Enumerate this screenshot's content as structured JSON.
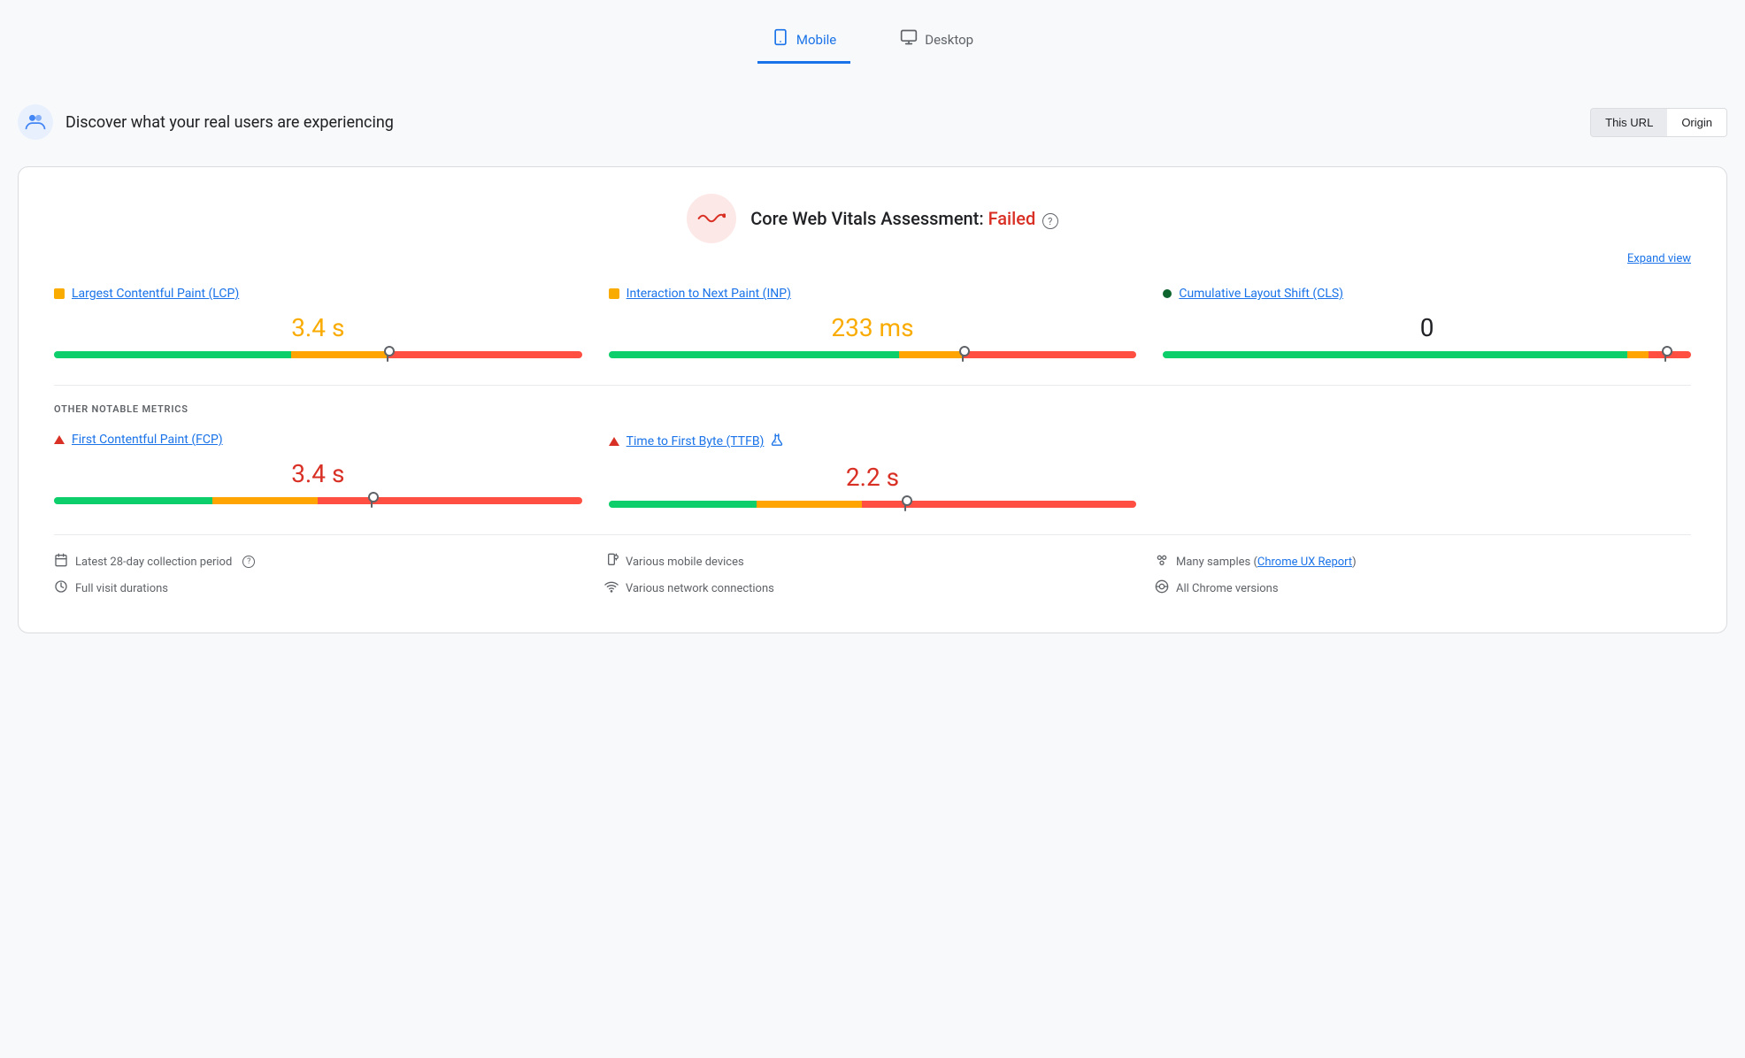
{
  "tabs": [
    {
      "id": "mobile",
      "label": "Mobile",
      "icon": "📱",
      "active": true
    },
    {
      "id": "desktop",
      "label": "Desktop",
      "icon": "🖥",
      "active": false
    }
  ],
  "header": {
    "title": "Discover what your real users are experiencing",
    "avatar_icon": "👥",
    "url_toggle": {
      "this_url": "This URL",
      "origin": "Origin",
      "active": "this_url"
    }
  },
  "assessment": {
    "title_prefix": "Core Web Vitals Assessment: ",
    "status": "Failed",
    "icon": "📉",
    "expand_label": "Expand view",
    "help_icon": "?"
  },
  "metrics": [
    {
      "id": "lcp",
      "label": "Largest Contentful Paint (LCP)",
      "dot_color": "orange",
      "value": "3.4 s",
      "value_color": "orange",
      "bar": {
        "green": 45,
        "orange": 18,
        "red": 37
      },
      "marker_pct": 63
    },
    {
      "id": "inp",
      "label": "Interaction to Next Paint (INP)",
      "dot_color": "orange",
      "value": "233 ms",
      "value_color": "orange",
      "bar": {
        "green": 55,
        "orange": 12,
        "red": 33
      },
      "marker_pct": 67
    },
    {
      "id": "cls",
      "label": "Cumulative Layout Shift (CLS)",
      "dot_color": "green",
      "value": "0",
      "value_color": "neutral",
      "bar": {
        "green": 88,
        "orange": 4,
        "red": 8
      },
      "marker_pct": 95
    }
  ],
  "other_metrics_title": "OTHER NOTABLE METRICS",
  "other_metrics": [
    {
      "id": "fcp",
      "label": "First Contentful Paint (FCP)",
      "icon": "triangle",
      "value": "3.4 s",
      "value_color": "red",
      "bar": {
        "green": 30,
        "orange": 20,
        "red": 50
      },
      "marker_pct": 60
    },
    {
      "id": "ttfb",
      "label": "Time to First Byte (TTFB)",
      "icon": "triangle",
      "extra_icon": "flask",
      "value": "2.2 s",
      "value_color": "red",
      "bar": {
        "green": 28,
        "orange": 20,
        "red": 52
      },
      "marker_pct": 56
    }
  ],
  "footer": {
    "col1": [
      {
        "icon": "📅",
        "text": "Latest 28-day collection period",
        "has_help": true
      },
      {
        "icon": "⏱",
        "text": "Full visit durations"
      }
    ],
    "col2": [
      {
        "icon": "📱",
        "text": "Various mobile devices"
      },
      {
        "icon": "📶",
        "text": "Various network connections"
      }
    ],
    "col3": [
      {
        "icon": "⚙️",
        "text_prefix": "Many samples ",
        "link_text": "Chrome UX Report",
        "text_suffix": ""
      },
      {
        "icon": "🔄",
        "text": "All Chrome versions"
      }
    ]
  }
}
